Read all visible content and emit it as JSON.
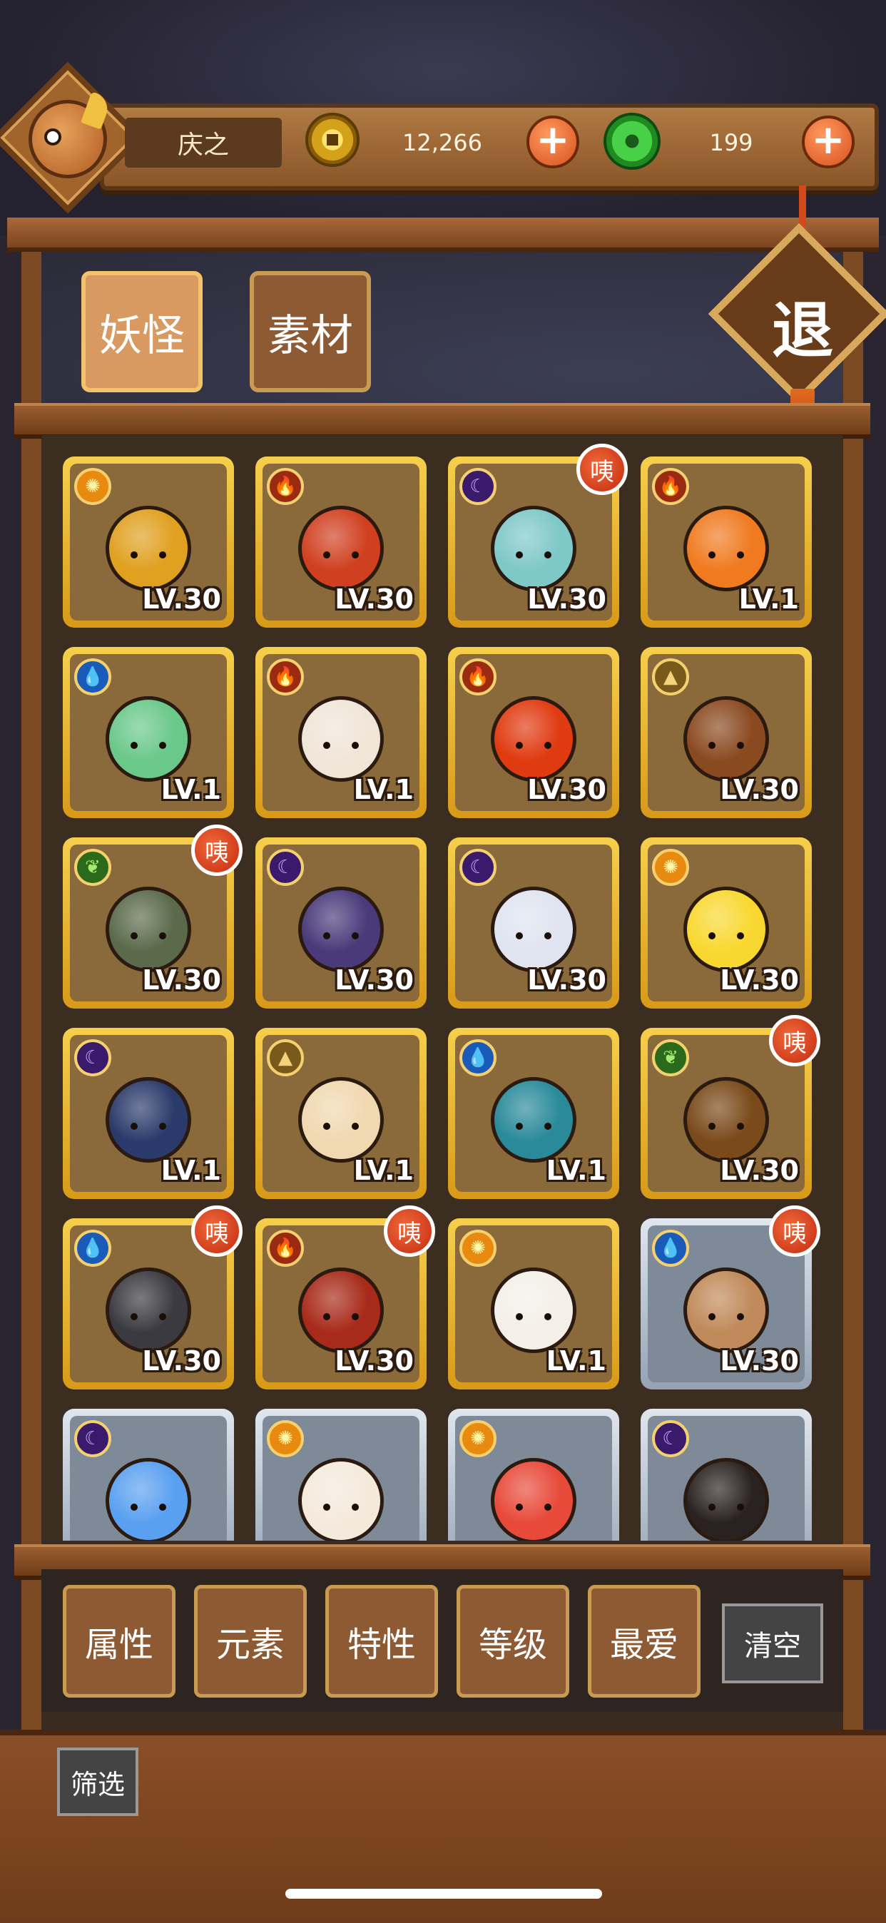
{
  "header": {
    "player_name": "庆之",
    "coins": "12,266",
    "gems": "199",
    "plus_label": "+"
  },
  "tabs": [
    {
      "label": "妖怪",
      "active": true
    },
    {
      "label": "素材",
      "active": false
    }
  ],
  "exit_label": "退",
  "cards": [
    {
      "element": "light",
      "level": "LV.30",
      "frame": "gold",
      "badge": "",
      "color": "#e0a020"
    },
    {
      "element": "fire",
      "level": "LV.30",
      "frame": "gold",
      "badge": "",
      "color": "#d04020"
    },
    {
      "element": "dark",
      "level": "LV.30",
      "frame": "gold",
      "badge": "咦",
      "color": "#7fc8c8"
    },
    {
      "element": "fire",
      "level": "LV.1",
      "frame": "gold",
      "badge": "",
      "color": "#f07a20"
    },
    {
      "element": "water",
      "level": "LV.1",
      "frame": "gold",
      "badge": "",
      "color": "#6ac88a"
    },
    {
      "element": "fire",
      "level": "LV.1",
      "frame": "gold",
      "badge": "",
      "color": "#f0e6d8"
    },
    {
      "element": "fire",
      "level": "LV.30",
      "frame": "gold",
      "badge": "",
      "color": "#e03a10"
    },
    {
      "element": "earth",
      "level": "LV.30",
      "frame": "gold",
      "badge": "",
      "color": "#8a4a20"
    },
    {
      "element": "wood",
      "level": "LV.30",
      "frame": "gold",
      "badge": "咦",
      "color": "#5a6a4a"
    },
    {
      "element": "dark",
      "level": "LV.30",
      "frame": "gold",
      "badge": "",
      "color": "#4a3a7a"
    },
    {
      "element": "dark",
      "level": "LV.30",
      "frame": "gold",
      "badge": "",
      "color": "#dfe4f0"
    },
    {
      "element": "light",
      "level": "LV.30",
      "frame": "gold",
      "badge": "",
      "color": "#f8d830"
    },
    {
      "element": "dark",
      "level": "LV.1",
      "frame": "gold",
      "badge": "",
      "color": "#2a3a6a"
    },
    {
      "element": "earth",
      "level": "LV.1",
      "frame": "gold",
      "badge": "",
      "color": "#f0d8b0"
    },
    {
      "element": "water",
      "level": "LV.1",
      "frame": "gold",
      "badge": "",
      "color": "#2a8a9a"
    },
    {
      "element": "wood",
      "level": "LV.30",
      "frame": "gold",
      "badge": "咦",
      "color": "#7a4a1a"
    },
    {
      "element": "water",
      "level": "LV.30",
      "frame": "gold",
      "badge": "咦",
      "color": "#3a3a40"
    },
    {
      "element": "fire",
      "level": "LV.30",
      "frame": "gold",
      "badge": "咦",
      "color": "#a82a1a"
    },
    {
      "element": "light",
      "level": "LV.1",
      "frame": "gold",
      "badge": "",
      "color": "#f4f0e8"
    },
    {
      "element": "water",
      "level": "LV.30",
      "frame": "silver",
      "badge": "咦",
      "color": "#c08a5a"
    },
    {
      "element": "dark",
      "level": "",
      "frame": "silver",
      "badge": "",
      "color": "#5aa0f0"
    },
    {
      "element": "light",
      "level": "",
      "frame": "silver",
      "badge": "",
      "color": "#f4eadc"
    },
    {
      "element": "light",
      "level": "",
      "frame": "silver",
      "badge": "",
      "color": "#e84a3a"
    },
    {
      "element": "dark",
      "level": "",
      "frame": "silver",
      "badge": "",
      "color": "#2a2220"
    }
  ],
  "filters": [
    "属性",
    "元素",
    "特性",
    "等级",
    "最爱"
  ],
  "clear_label": "清空",
  "filter_tag": "筛选"
}
